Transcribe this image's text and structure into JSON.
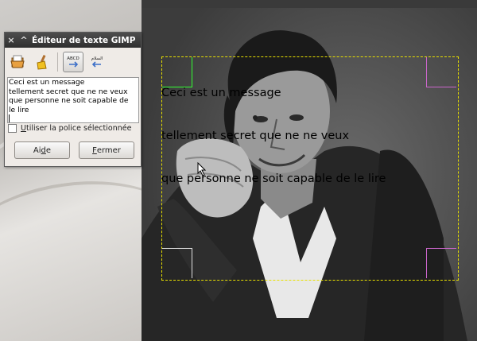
{
  "dialog": {
    "title": "Éditeur de texte GIMP",
    "close_glyph": "×",
    "collapse_glyph": "^",
    "tools": [
      {
        "icon": "open-file-icon"
      },
      {
        "icon": "clear-brush-icon"
      },
      {
        "icon": "ltr-text-icon",
        "label": "ABCD"
      },
      {
        "icon": "rtl-text-icon",
        "label": "السلام"
      }
    ],
    "text_lines": [
      "Ceci est un message",
      "tellement secret que ne ne veux",
      "que personne ne soit capable de",
      "le lire"
    ],
    "checkbox": {
      "label_first": "U",
      "label_rest": "tiliser la police sélectionnée",
      "checked": false
    },
    "help_button": {
      "before": "Ai",
      "underlined": "d",
      "after": "e"
    },
    "close_button": {
      "before": "",
      "underlined": "F",
      "after": "ermer"
    }
  },
  "canvas": {
    "text_lines": [
      "Ceci est un message",
      "tellement secret que ne ne veux",
      "que personne ne soit capable de le lire"
    ],
    "colors": {
      "frame": "#e8e000",
      "handle_green": "#33ff33",
      "handle_pink": "#cc66cc"
    }
  }
}
